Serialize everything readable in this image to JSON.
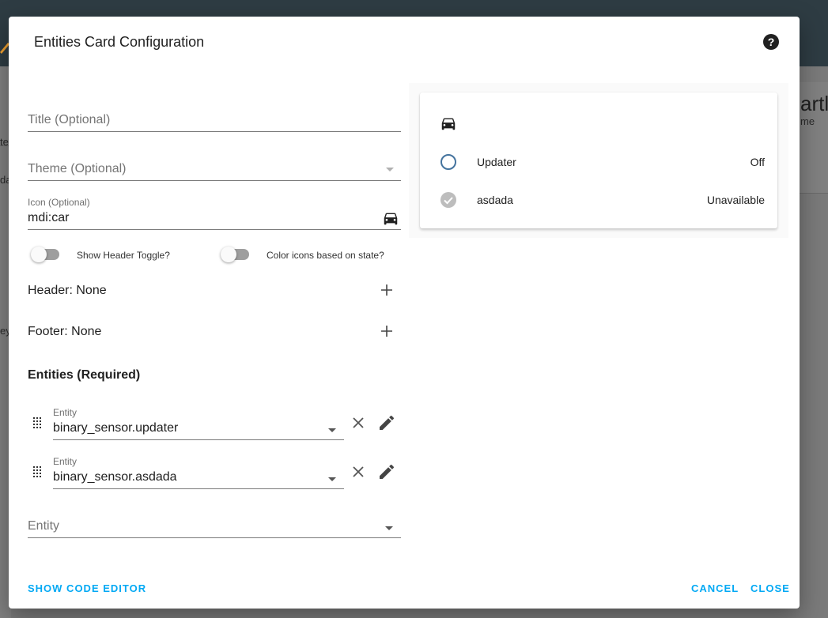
{
  "background": {
    "left_texts": [
      "te",
      "da",
      "ey"
    ],
    "big_text": "artl",
    "sub_text": "me"
  },
  "dialog": {
    "title": "Entities Card Configuration",
    "help_icon": "help-circle-icon"
  },
  "form": {
    "title_placeholder": "Title (Optional)",
    "theme_placeholder": "Theme (Optional)",
    "icon_label": "Icon (Optional)",
    "icon_value": "mdi:car",
    "toggles": [
      {
        "label": "Show Header Toggle?",
        "on": false
      },
      {
        "label": "Color icons based on state?",
        "on": false
      }
    ],
    "header_label": "Header: None",
    "footer_label": "Footer: None",
    "entities_title": "Entities (Required)",
    "entities": [
      {
        "label": "Entity",
        "value": "binary_sensor.updater"
      },
      {
        "label": "Entity",
        "value": "binary_sensor.asdada"
      }
    ],
    "new_entity_placeholder": "Entity"
  },
  "preview": {
    "header_icon": "car-icon",
    "rows": [
      {
        "icon": "circle-outline-icon",
        "name": "Updater",
        "state": "Off"
      },
      {
        "icon": "check-circle-icon",
        "name": "asdada",
        "state": "Unavailable"
      }
    ]
  },
  "footer": {
    "show_code_editor": "SHOW CODE EDITOR",
    "cancel": "CANCEL",
    "close": "CLOSE"
  },
  "colors": {
    "accent": "#03a9f4",
    "updater_icon": "#44739e",
    "unavailable_icon": "#bdbdbd"
  }
}
